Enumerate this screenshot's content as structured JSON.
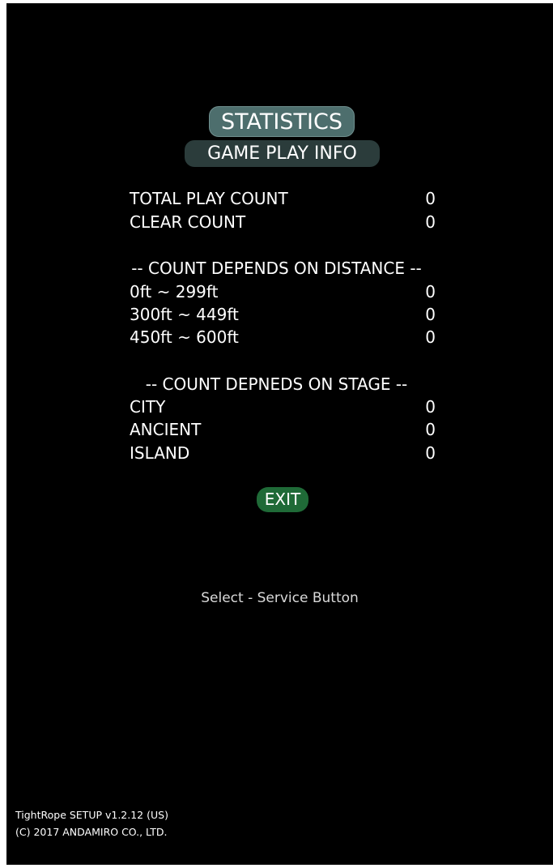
{
  "header": {
    "title": "STATISTICS",
    "subtitle": "GAME PLAY INFO"
  },
  "summary": {
    "total_play_count_label": "TOTAL PLAY COUNT",
    "total_play_count_value": "0",
    "clear_count_label": "CLEAR COUNT",
    "clear_count_value": "0"
  },
  "distance": {
    "header": "-- COUNT DEPENDS ON DISTANCE --",
    "rows": [
      {
        "label": "0ft ~ 299ft",
        "value": "0"
      },
      {
        "label": "300ft ~ 449ft",
        "value": "0"
      },
      {
        "label": "450ft ~ 600ft",
        "value": "0"
      }
    ]
  },
  "stage": {
    "header": "-- COUNT DEPNEDS ON STAGE --",
    "rows": [
      {
        "label": "CITY",
        "value": "0"
      },
      {
        "label": "ANCIENT",
        "value": "0"
      },
      {
        "label": "ISLAND",
        "value": "0"
      }
    ]
  },
  "menu": {
    "exit_label": "EXIT"
  },
  "hint": "Select - Service Button",
  "footer": {
    "version": "TightRope SETUP v1.2.12 (US)",
    "copyright": "(C) 2017 ANDAMIRO CO., LTD."
  },
  "colors": {
    "background": "#000000",
    "title_pill": "#4d6e6d",
    "subtitle_pill": "#2b3c3b",
    "exit_pill": "#1f6a37"
  }
}
